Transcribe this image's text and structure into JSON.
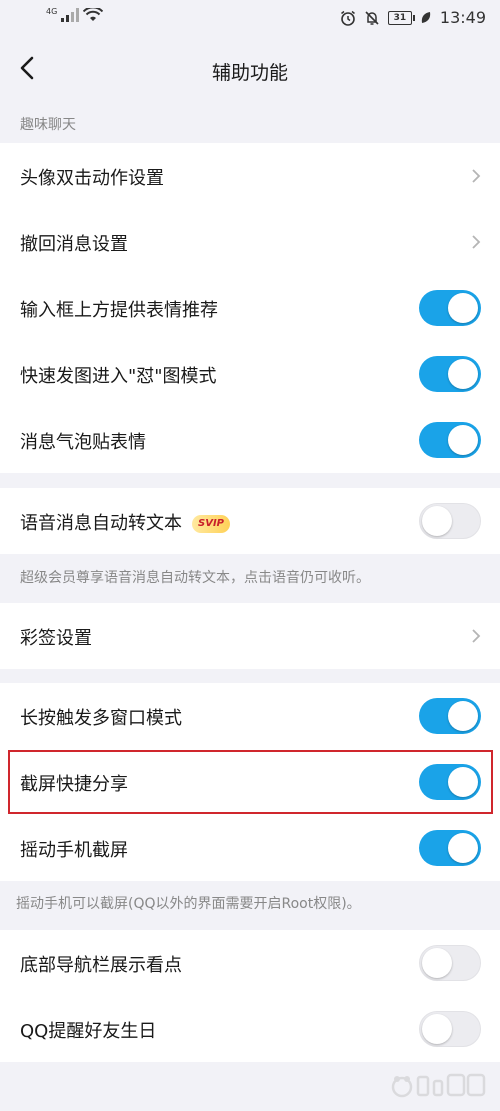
{
  "status_bar": {
    "network": "4G",
    "battery": "31",
    "time": "13:49"
  },
  "header": {
    "title": "辅助功能"
  },
  "sections": {
    "fun_chat_label": "趣味聊天"
  },
  "group1": [
    {
      "label": "头像双击动作设置",
      "control": "chevron"
    },
    {
      "label": "撤回消息设置",
      "control": "chevron"
    },
    {
      "label": "输入框上方提供表情推荐",
      "control": "toggle",
      "state": "on"
    },
    {
      "label": "快速发图进入\"怼\"图模式",
      "control": "toggle",
      "state": "on"
    },
    {
      "label": "消息气泡贴表情",
      "control": "toggle",
      "state": "on"
    }
  ],
  "group2": {
    "label": "语音消息自动转文本",
    "badge": "SVIP",
    "state": "off",
    "note": "超级会员尊享语音消息自动转文本，点击语音仍可收听。"
  },
  "group3": {
    "label": "彩签设置"
  },
  "group4": [
    {
      "label": "长按触发多窗口模式",
      "state": "on"
    },
    {
      "label": "截屏快捷分享",
      "state": "on"
    },
    {
      "label": "摇动手机截屏",
      "state": "on"
    }
  ],
  "group4_note": "摇动手机可以截屏(QQ以外的界面需要开启Root权限)。",
  "group5": [
    {
      "label": "底部导航栏展示看点",
      "state": "off"
    },
    {
      "label": "QQ提醒好友生日",
      "state": "off"
    }
  ],
  "colors": {
    "toggle_on": "#1aa3e8",
    "highlight": "#d0262d"
  }
}
